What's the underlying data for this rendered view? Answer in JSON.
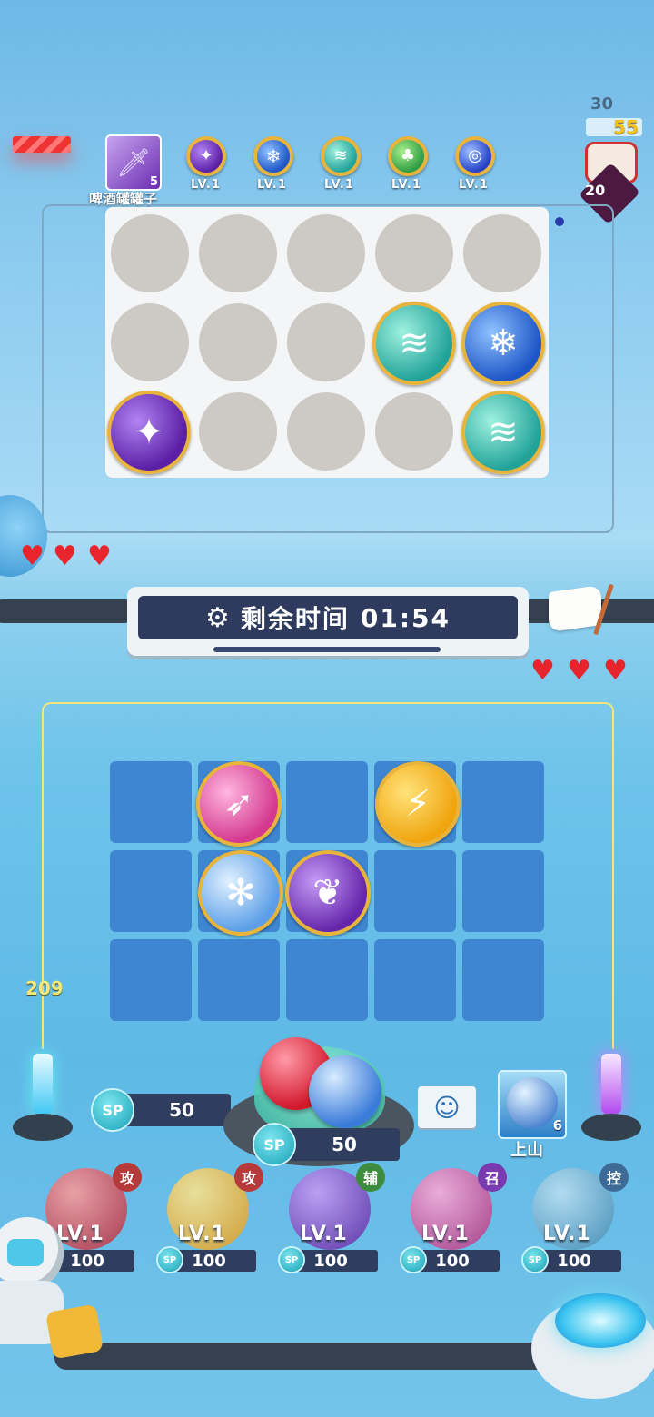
{
  "opponent": {
    "name": "啤酒罐罐子",
    "level_badge": "5",
    "score_top": "30",
    "score_gold": "55",
    "score_small": "20",
    "deck": [
      {
        "icon": "sword-orb-icon",
        "level": "LV.1"
      },
      {
        "icon": "snowflake-orb-icon",
        "level": "LV.1"
      },
      {
        "icon": "wind-orb-icon",
        "level": "LV.1"
      },
      {
        "icon": "leaf-orb-icon",
        "level": "LV.1"
      },
      {
        "icon": "vortex-orb-icon",
        "level": "LV.1"
      }
    ]
  },
  "timer": {
    "label": "剩余时间",
    "value": "01:54"
  },
  "player": {
    "wave_counter": "209",
    "sp_left": "50",
    "sp_summon": "50",
    "emote_icon": "smiley-icon",
    "skill": {
      "label": "上山",
      "badge": "6"
    },
    "upgrades": [
      {
        "level": "LV.1",
        "cost": "100",
        "tag": "攻",
        "color": "#c33a3a"
      },
      {
        "level": "LV.1",
        "cost": "100",
        "tag": "攻",
        "color": "#c33a3a"
      },
      {
        "level": "LV.1",
        "cost": "100",
        "tag": "辅",
        "color": "#3a8a3a"
      },
      {
        "level": "LV.1",
        "cost": "100",
        "tag": "召",
        "color": "#8a3ab0"
      },
      {
        "level": "LV.1",
        "cost": "100",
        "tag": "控",
        "color": "#3a6a9a"
      }
    ],
    "sp_symbol": "SP"
  },
  "colors": {
    "accent": "#2e3a5e",
    "heart": "#e8242d",
    "frame": "#f2e777"
  }
}
